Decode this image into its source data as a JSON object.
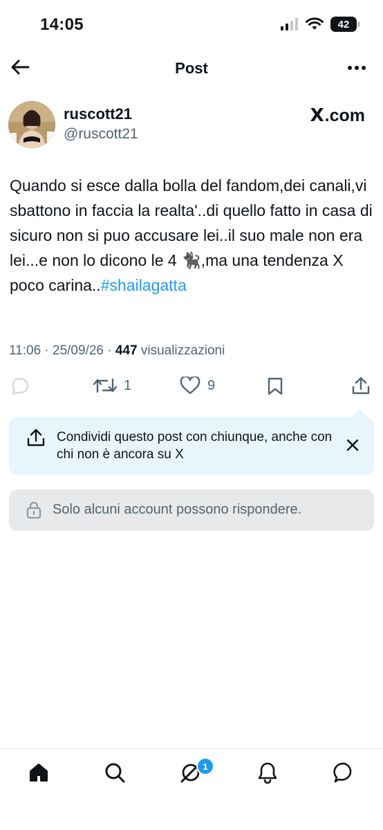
{
  "status_bar": {
    "time": "14:05",
    "battery": "42",
    "icons": [
      "signal-icon",
      "wifi-icon",
      "battery-icon"
    ]
  },
  "header": {
    "title": "Post",
    "back_icon": "arrow-left-icon",
    "more_icon": "more-horizontal-icon"
  },
  "author": {
    "display_name": "ruscott21",
    "handle": "@ruscott21",
    "source_label": ".com",
    "source_logo": "X"
  },
  "tweet": {
    "text": "Quando si esce dalla bolla del fandom,dei canali,vi sbattono in faccia la realta'..di quello fatto in casa di sicuro non si puo accusare lei..il suo male non era lei...e non lo dicono le 4 🐈‍⬛,ma una tendenza X poco carina..",
    "hashtag": "#shailagatta",
    "time": "11:06 · 25/09/26 · ",
    "views_count": "447",
    "views_label": " visualizzazioni"
  },
  "actions": {
    "reply_icon": "reply-icon",
    "retweet_count": "1",
    "like_count": "9",
    "bookmark_icon": "bookmark-icon",
    "share_icon": "share-icon"
  },
  "share_banner": {
    "text": "Condividi questo post con chiunque, anche con chi non è ancora su X",
    "close_icon": "close-icon"
  },
  "reply_restriction": {
    "text": "Solo alcuni account possono rispondere."
  },
  "bottom_nav": {
    "items": [
      "home-icon",
      "search-icon",
      "grok-icon",
      "notifications-icon",
      "messages-icon"
    ],
    "grok_badge": "1"
  },
  "colors": {
    "accent": "#1d9bf0",
    "text_primary": "#0f1419",
    "text_secondary": "#536471",
    "banner_bg": "#e8f5fd",
    "restrict_bg": "#e7e9ea"
  }
}
